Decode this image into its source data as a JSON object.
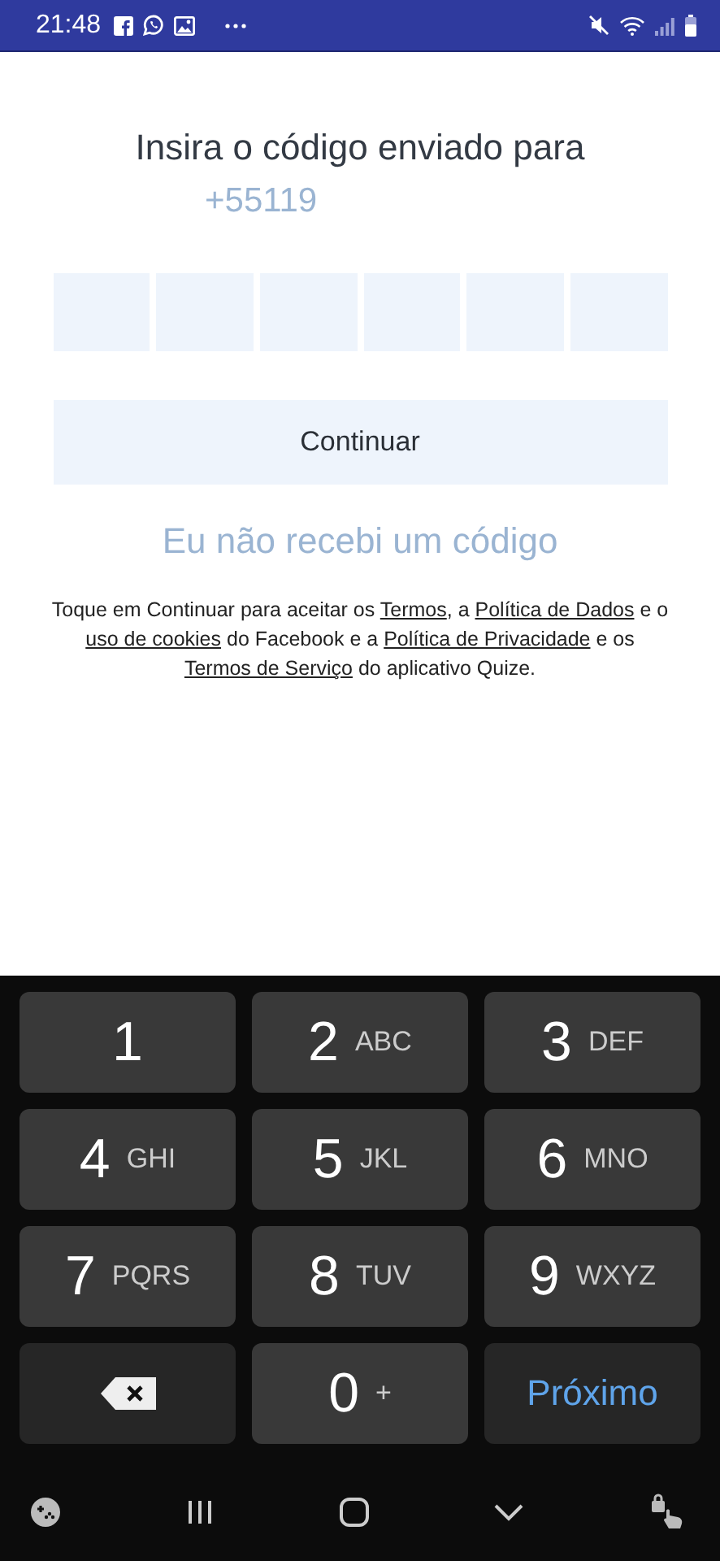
{
  "status_bar": {
    "time": "21:48"
  },
  "title": "Insira o código enviado para",
  "phone": "+55119",
  "code_cells": [
    {
      "filled": false
    },
    {
      "filled": false
    },
    {
      "filled": false
    },
    {
      "filled": false
    },
    {
      "filled": false
    },
    {
      "filled": false
    }
  ],
  "continue_button": {
    "label": "Continuar",
    "disabled": true
  },
  "resend_link": "Eu não recebi um código",
  "terms": [
    {
      "text": "Toque em Continuar para aceitar os ",
      "link": false
    },
    {
      "text": "Termos",
      "link": true
    },
    {
      "text": ", a ",
      "link": false
    },
    {
      "text": "Política de Dados",
      "link": true
    },
    {
      "text": " e o ",
      "link": false
    },
    {
      "text": "uso de cookies",
      "link": true
    },
    {
      "text": " do Facebook e a ",
      "link": false
    },
    {
      "text": "Política de Privacidade",
      "link": true
    },
    {
      "text": " e os ",
      "link": false
    },
    {
      "text": "Termos de Serviço",
      "link": true
    },
    {
      "text": " do aplicativo Quize.",
      "link": false
    }
  ],
  "keyboard": [
    {
      "kind": "digit",
      "digit": "1"
    },
    {
      "kind": "digit",
      "digit": "2",
      "letters": "ABC"
    },
    {
      "kind": "digit",
      "digit": "3",
      "letters": "DEF"
    },
    {
      "kind": "digit",
      "digit": "4",
      "letters": "GHI"
    },
    {
      "kind": "digit",
      "digit": "5",
      "letters": "JKL"
    },
    {
      "kind": "digit",
      "digit": "6",
      "letters": "MNO"
    },
    {
      "kind": "digit",
      "digit": "7",
      "letters": "PQRS"
    },
    {
      "kind": "digit",
      "digit": "8",
      "letters": "TUV"
    },
    {
      "kind": "digit",
      "digit": "9",
      "letters": "WXYZ"
    },
    {
      "kind": "backspace"
    },
    {
      "kind": "digit",
      "digit": "0",
      "letters": "+"
    },
    {
      "kind": "action",
      "label": "Próximo"
    }
  ]
}
